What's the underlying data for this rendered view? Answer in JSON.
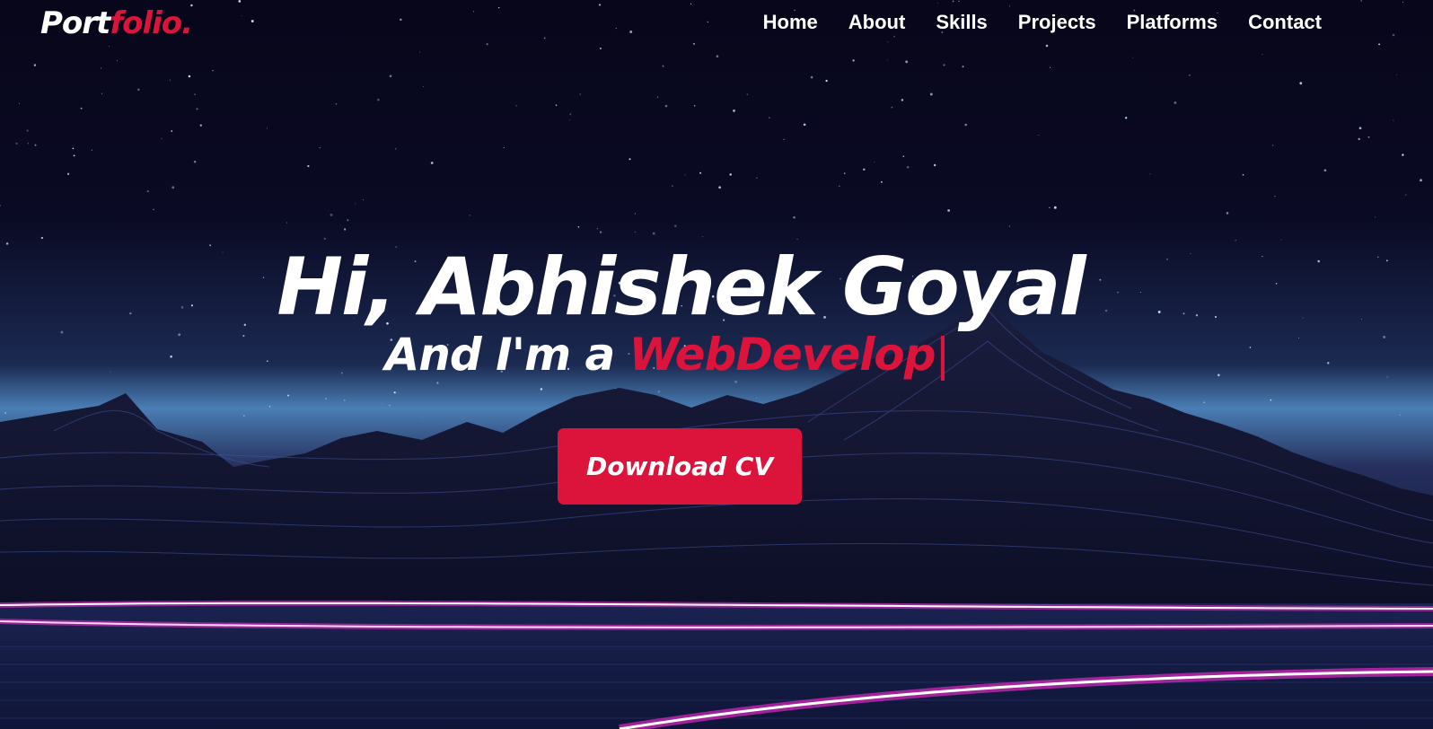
{
  "nav": {
    "logo_main": "Port",
    "logo_accent": "folio.",
    "items": [
      {
        "label": "Home"
      },
      {
        "label": "About"
      },
      {
        "label": "Skills"
      },
      {
        "label": "Projects"
      },
      {
        "label": "Platforms"
      },
      {
        "label": "Contact"
      }
    ]
  },
  "hero": {
    "greeting": "Hi, Abhishek Goyal",
    "intro": "And I'm a ",
    "role": "WebDevelop",
    "cursor": "|",
    "cta_label": "Download CV"
  },
  "colors": {
    "accent": "#dc143c",
    "text": "#ffffff",
    "background": "#07061a"
  }
}
